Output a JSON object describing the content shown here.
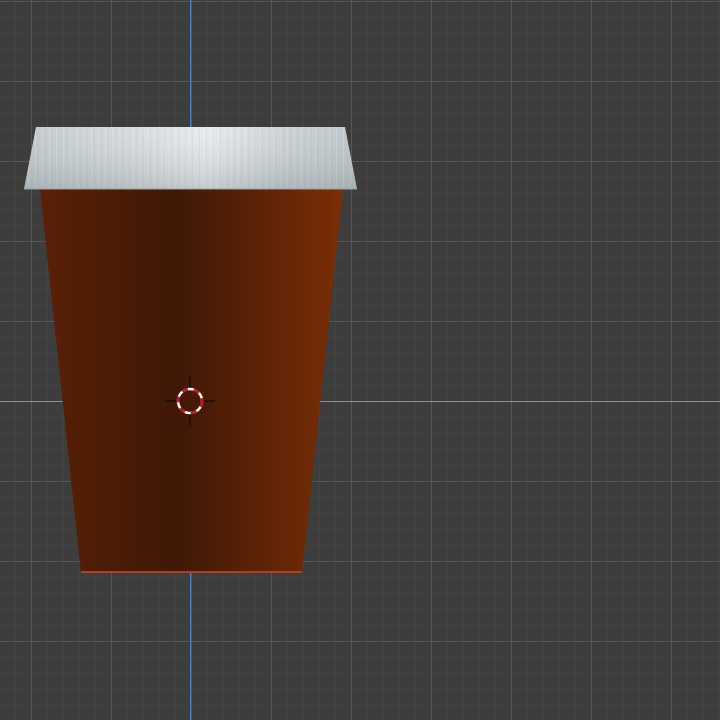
{
  "viewport": {
    "background_color": "#3d3d3d",
    "grid_color": "#5a5a5a",
    "axis_x_color": "#7fa83a",
    "axis_y_color": "#4f7fc4"
  },
  "object": {
    "name": "",
    "lid_color": "#c9d1d4",
    "cup_color_dark": "#3a1606",
    "cup_color_light": "#7a2e05"
  },
  "cursor": {
    "icon": "3d-cursor-icon",
    "ring_colors": [
      "#ffffff",
      "#c8102e"
    ]
  }
}
